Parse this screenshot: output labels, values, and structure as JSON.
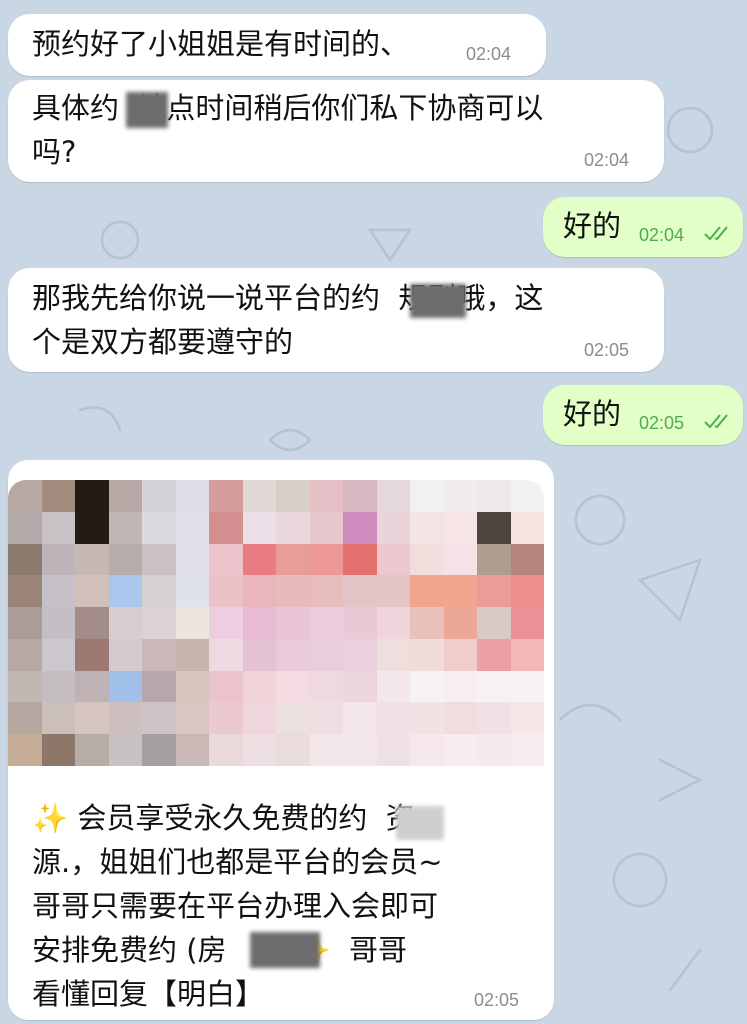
{
  "messages": [
    {
      "id": "m1",
      "dir": "in",
      "text": "预约好了小姐姐是有时间的、",
      "time": "02:04"
    },
    {
      "id": "m2",
      "dir": "in",
      "text": "具体约  地点时间稍后你们私下协商可以\n吗?",
      "time": "02:04"
    },
    {
      "id": "m3",
      "dir": "out",
      "text": "好的",
      "time": "02:04",
      "read": true
    },
    {
      "id": "m4",
      "dir": "in",
      "text": "那我先给你说一说平台的约  规则哦，这\n个是双方都要遵守的",
      "time": "02:05"
    },
    {
      "id": "m5",
      "dir": "out",
      "text": "好的",
      "time": "02:05",
      "read": true
    },
    {
      "id": "m6",
      "dir": "in",
      "media": "pixelated-image",
      "text": "✨ 会员享受永久免费的约  资\n源.，姐姐们也都是平台的会员~\n哥哥只需要在平台办理入会即可\n安排免费约 (房   理)✨  哥哥\n看懂回复【明白】",
      "time": "02:05"
    }
  ],
  "colors": {
    "incoming": "#ffffff",
    "outgoing": "#e1ffc7",
    "wallpaper": "#c9d6e3",
    "time_out": "#4fae4e",
    "time_in": "#8c8c8c"
  },
  "mosaic_palette": [
    [
      "#b7a9a2",
      "#a08b7e",
      "#241a14",
      "#b6a9a6",
      "#d6d3d8",
      "#dcdde6",
      "#d59c9c",
      "#e2d8d6",
      "#d8cfc6",
      "#e4c0c6",
      "#d8b9c1",
      "#e5d8da",
      "#f1f1f3",
      "#f2ecec",
      "#eeeaea",
      "#f3f1f0"
    ],
    [
      "#b4aaa9",
      "#c6c2c5",
      "#251a16",
      "#c2b6b5",
      "#d9d9e0",
      "#e1e1ea",
      "#d49091",
      "#ecdfe7",
      "#e9d7dc",
      "#e7c6cd",
      "#cd8bbe",
      "#ead4da",
      "#f2e3e5",
      "#f7e5e6",
      "#4e443f",
      "#f4e3e1"
    ],
    [
      "#8c7a6f",
      "#bdb4b9",
      "#c8b8b2",
      "#b8adad",
      "#cbc0c4",
      "#dfe0ea",
      "#edc3cb",
      "#e87c82",
      "#e99d97",
      "#ec9996",
      "#e4726e",
      "#ebc9cf",
      "#f3dcdc",
      "#f6e2e6",
      "#b19c90",
      "#b7847e"
    ],
    [
      "#9a8578",
      "#c6c1c6",
      "#d1bfba",
      "#a9c7ec",
      "#d7d0d3",
      "#e0e2eb",
      "#ecc2c9",
      "#e9b6bb",
      "#e7bbbb",
      "#e7bdbb",
      "#e3c4c7",
      "#e1c5c7",
      "#f1a58e",
      "#f0a68f",
      "#e99c98",
      "#ec8f8c"
    ],
    [
      "#aa9c98",
      "#c5bec4",
      "#a48c89",
      "#d7cdcf",
      "#dcd2d3",
      "#ede6dd",
      "#efcde1",
      "#e7bbd1",
      "#e9c4d6",
      "#edccdb",
      "#eac9d6",
      "#eed5dc",
      "#e8c1bb",
      "#eba797",
      "#d8cbc6",
      "#ec9296"
    ],
    [
      "#b6a8a4",
      "#cbc7cc",
      "#9c7a72",
      "#d4cbd0",
      "#c9b8b7",
      "#c6b4aa",
      "#eed8e1",
      "#e3c3d3",
      "#e8cad8",
      "#e8cddd",
      "#eacfdc",
      "#efdede",
      "#f1dcda",
      "#efcdc9",
      "#eba1a3",
      "#f1b8b5"
    ],
    [
      "#c3b7b2",
      "#c4bdc1",
      "#bfb2b4",
      "#a0bfe9",
      "#b8a7aa",
      "#d9c5bc",
      "#ebc3cc",
      "#f1d3d9",
      "#f3dbe1",
      "#efd9de",
      "#ecd5dc",
      "#f4e7ea",
      "#f6f2f3",
      "#f7efef",
      "#f8f1f1",
      "#f8f2f2"
    ],
    [
      "#b5a8a1",
      "#cbbfba",
      "#d6c5bf",
      "#cdbfbf",
      "#cbc3c6",
      "#dbc7c1",
      "#ecc9d1",
      "#efd6dc",
      "#ecdfe0",
      "#eedee1",
      "#f2e6ec",
      "#efe1e5",
      "#f3e2e3",
      "#f1dde0",
      "#f2e1e4",
      "#f5e6e8"
    ],
    [
      "#c5ac96",
      "#8c7768",
      "#b8aca6",
      "#c8c1c3",
      "#a39e9f",
      "#c9b8b5",
      "#ead9db",
      "#eedfe2",
      "#ebdcdc",
      "#f2e6e8",
      "#f3e7ea",
      "#efe0e3",
      "#f6e8ea",
      "#f8ecee",
      "#f6eaec",
      "#f6ecee"
    ]
  ]
}
